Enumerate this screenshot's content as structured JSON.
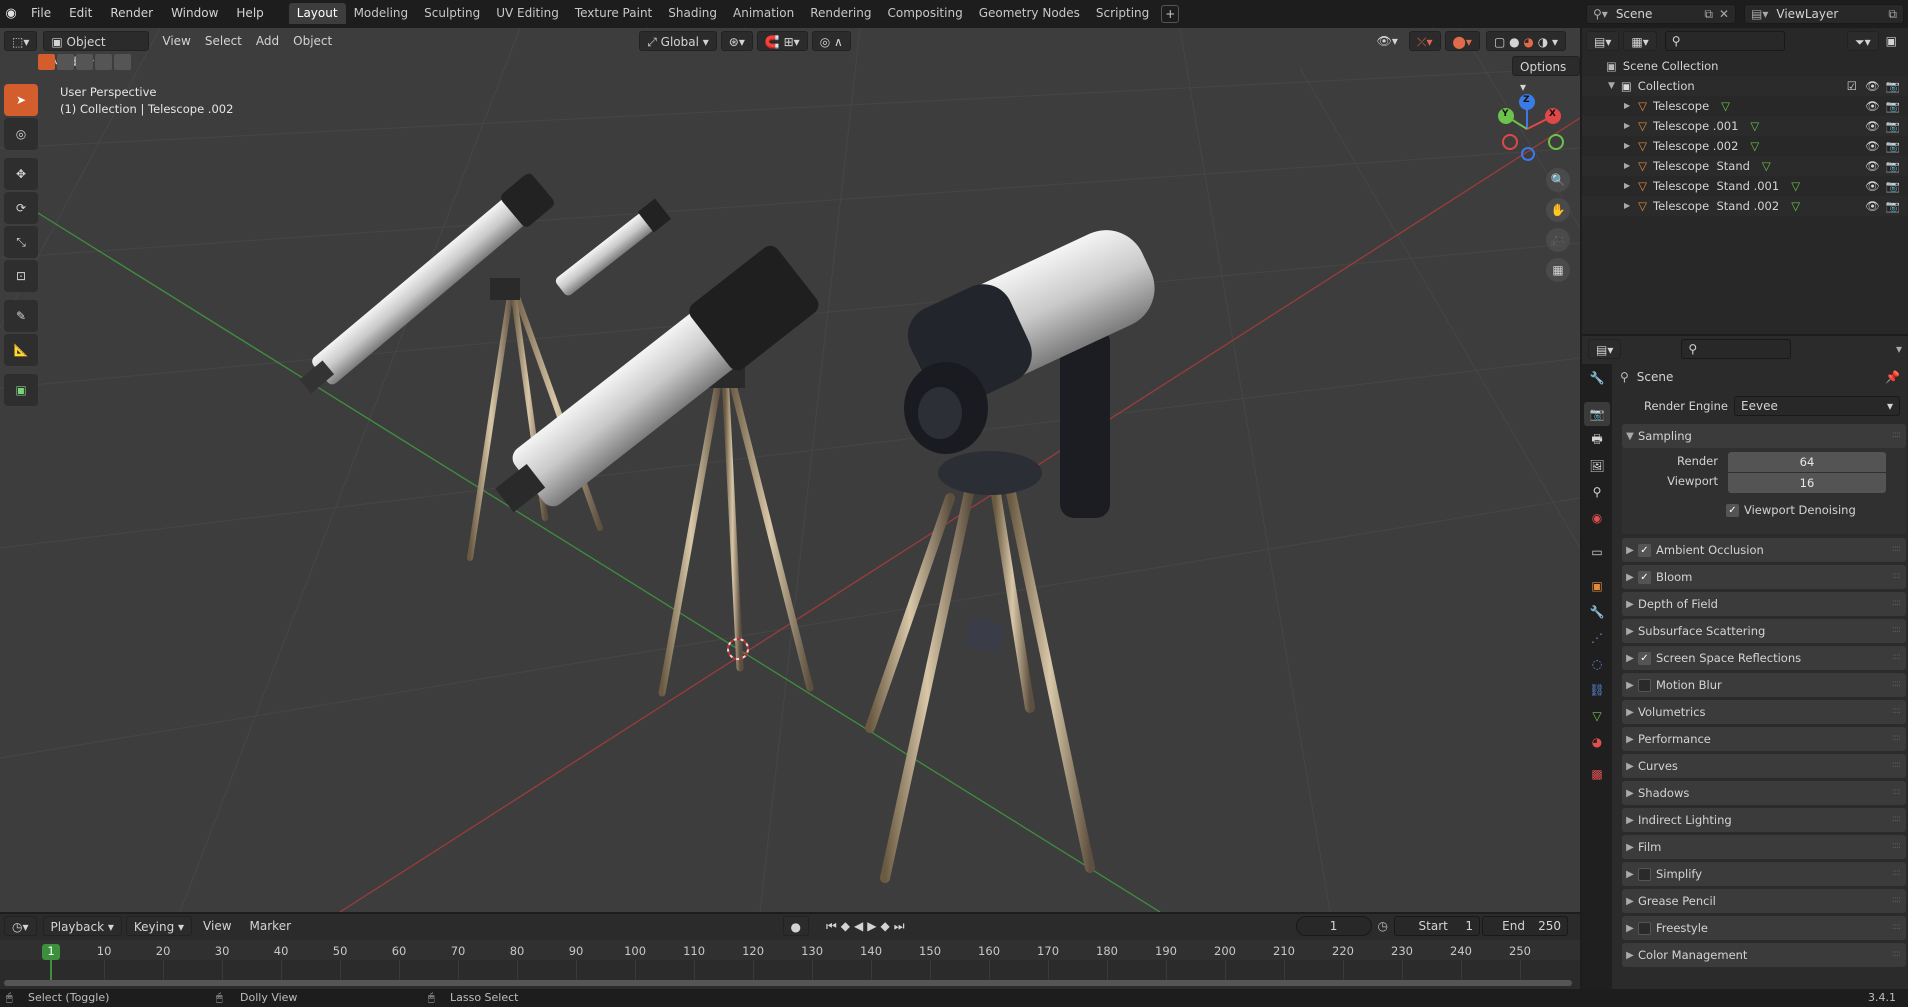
{
  "topbar": {
    "menus": [
      "File",
      "Edit",
      "Render",
      "Window",
      "Help"
    ],
    "workspaces": [
      "Layout",
      "Modeling",
      "Sculpting",
      "UV Editing",
      "Texture Paint",
      "Shading",
      "Animation",
      "Rendering",
      "Compositing",
      "Geometry Nodes",
      "Scripting"
    ],
    "active_workspace": "Layout",
    "add_tab": "+",
    "scene": "Scene",
    "view_layer": "ViewLayer"
  },
  "viewport": {
    "mode": "Object Mode",
    "menus": [
      "View",
      "Select",
      "Add",
      "Object"
    ],
    "transform_orientation": "Global",
    "options_label": "Options",
    "info_line1": "User Perspective",
    "info_line2": "(1) Collection | Telescope .002",
    "gizmo": {
      "x": "X",
      "y": "Y",
      "z": "Z"
    }
  },
  "outliner": {
    "root": "Scene Collection",
    "collection": "Collection",
    "items": [
      "Telescope",
      "Telescope .001",
      "Telescope .002",
      "Telescope  Stand",
      "Telescope  Stand .001",
      "Telescope  Stand .002"
    ]
  },
  "properties": {
    "context": "Scene",
    "render_engine_label": "Render Engine",
    "render_engine": "Eevee",
    "sampling": {
      "title": "Sampling",
      "render_label": "Render",
      "render_value": "64",
      "viewport_label": "Viewport",
      "viewport_value": "16",
      "denoise_label": "Viewport Denoising"
    },
    "panels": [
      {
        "label": "Ambient Occlusion",
        "checkbox": true,
        "checked": true
      },
      {
        "label": "Bloom",
        "checkbox": true,
        "checked": true
      },
      {
        "label": "Depth of Field",
        "checkbox": false,
        "checked": false
      },
      {
        "label": "Subsurface Scattering",
        "checkbox": false,
        "checked": false
      },
      {
        "label": "Screen Space Reflections",
        "checkbox": true,
        "checked": true
      },
      {
        "label": "Motion Blur",
        "checkbox": true,
        "checked": false
      },
      {
        "label": "Volumetrics",
        "checkbox": false,
        "checked": false
      },
      {
        "label": "Performance",
        "checkbox": false,
        "checked": false
      },
      {
        "label": "Curves",
        "checkbox": false,
        "checked": false
      },
      {
        "label": "Shadows",
        "checkbox": false,
        "checked": false
      },
      {
        "label": "Indirect Lighting",
        "checkbox": false,
        "checked": false
      },
      {
        "label": "Film",
        "checkbox": false,
        "checked": false
      },
      {
        "label": "Simplify",
        "checkbox": true,
        "checked": false
      },
      {
        "label": "Grease Pencil",
        "checkbox": false,
        "checked": false
      },
      {
        "label": "Freestyle",
        "checkbox": true,
        "checked": false
      },
      {
        "label": "Color Management",
        "checkbox": false,
        "checked": false
      }
    ]
  },
  "timeline": {
    "menus": [
      "Playback",
      "Keying",
      "View",
      "Marker"
    ],
    "current_frame": "1",
    "start_label": "Start",
    "start": "1",
    "end_label": "End",
    "end": "250",
    "ticks": [
      "1",
      "10",
      "20",
      "30",
      "40",
      "50",
      "60",
      "70",
      "80",
      "90",
      "100",
      "110",
      "120",
      "130",
      "140",
      "150",
      "160",
      "170",
      "180",
      "190",
      "200",
      "210",
      "220",
      "230",
      "240",
      "250"
    ]
  },
  "status": {
    "select": "Select (Toggle)",
    "dolly": "Dolly View",
    "lasso": "Lasso Select",
    "version": "3.4.1"
  }
}
